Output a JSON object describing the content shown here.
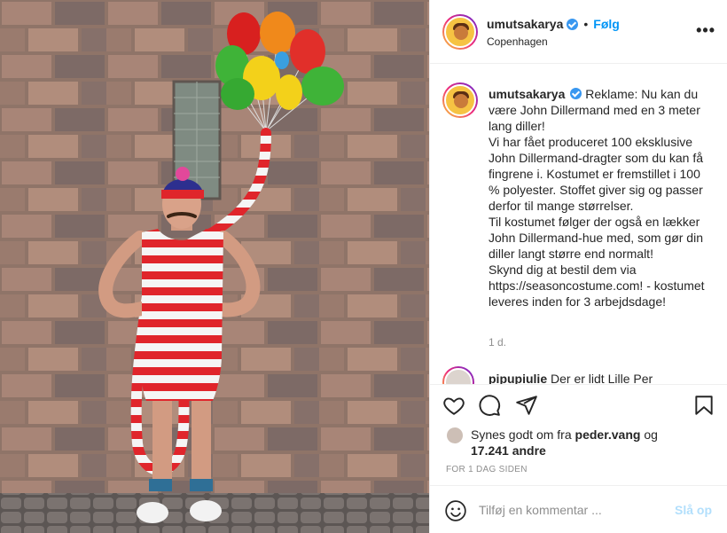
{
  "post": {
    "author": "umutsakarya",
    "verified": true,
    "separator": "•",
    "follow_label": "Følg",
    "location": "Copenhagen",
    "more_icon": "more-options-icon",
    "more_glyph": "•••",
    "photo_alt": "Photo of man in striped swimsuit costume holding balloons"
  },
  "caption": {
    "author": "umutsakarya",
    "text": "Reklame: Nu kan du være John Dillermand med en 3 meter lang diller!\nVi har fået produceret 100 eksklusive John Dillermand-dragter som du kan få fingrene i. Kostumet er fremstillet i 100 % polyester. Stoffet giver sig og passer derfor til mange størrelser.\nTil kostumet følger der også en lækker John Dillermand-hue med, som gør din diller langt større end normalt!\nSkynd dig at bestil dem via https://seasoncostume.com! - kostumet leveres inden for 3 arbejdsdage!",
    "age": "1 d."
  },
  "comment_preview": {
    "author": "pipupiulie",
    "text": "Der er lidt Lille Per"
  },
  "actions": {
    "like_icon": "heart-icon",
    "comment_icon": "comment-icon",
    "share_icon": "share-icon",
    "save_icon": "bookmark-icon"
  },
  "likes": {
    "prefix": "Synes godt om fra ",
    "user": "peder.vang",
    "conj": " og",
    "count": "17.241 andre"
  },
  "timestamp": "FOR 1 DAG SIDEN",
  "comment_input": {
    "placeholder": "Tilføj en kommentar ...",
    "post_label": "Slå op",
    "emoji_icon": "emoji-icon"
  },
  "colors": {
    "accent": "#0095f6",
    "verified": "#3897f0",
    "post_disabled": "#b2dffc",
    "muted": "#8e8e8e",
    "stripe_red": "#e0252b"
  }
}
